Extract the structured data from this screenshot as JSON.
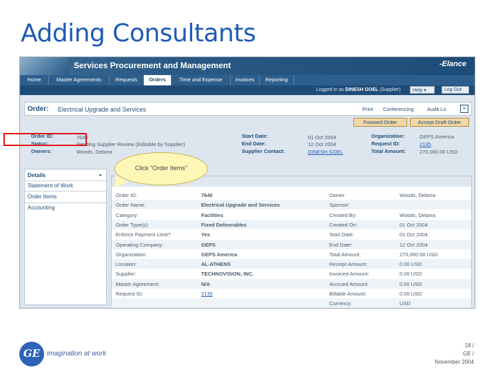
{
  "slide": {
    "title": "Adding Consultants",
    "footer": {
      "page": "18 /",
      "company": "GE /",
      "date": "November 2004"
    },
    "tagline": "imagination at work",
    "logo_text": "GE"
  },
  "app": {
    "banner_title": "Services Procurement and Management",
    "brand": "-Elance",
    "tabs": [
      "Home",
      "Master Agreements",
      "Requests",
      "Orders",
      "Time and Expense",
      "Invoices",
      "Reporting"
    ],
    "active_tab": "Orders",
    "user": {
      "prefix": "Logged in as",
      "name": "DINESH GOEL",
      "role": "(Supplier)",
      "help": "Help",
      "logout": "Log Out"
    },
    "order": {
      "label": "Order:",
      "name": "Electrical Upgrade and Services",
      "links": {
        "print": "Print",
        "conferencing": "Conferencing",
        "audit": "Audit Lo"
      },
      "close": "×"
    },
    "actions": {
      "forward": "Forward Order",
      "accept": "Accept Draft Order"
    },
    "summary": {
      "order_id_label": "Order ID:",
      "order_id": "7640",
      "status_label": "Status:",
      "status": "Pending Supplier Review (Editable by Supplier)",
      "owners_label": "Owners:",
      "owners": "Woods, Debora",
      "start_label": "Start Date:",
      "start": "01 Oct 2004",
      "end_label": "End Date:",
      "end": "12 Oct 2004",
      "contact_label": "Supplier Contact:",
      "contact": "DINESH GOEL",
      "org_label": "Organization:",
      "org": "GEPS America",
      "request_label": "Request ID:",
      "request": "2135",
      "total_label": "Total Amount:",
      "total": "270,000.00 USD"
    },
    "nav": {
      "items": [
        "Details",
        "Statement of Work",
        "Order Items",
        "Accounting"
      ],
      "arrow": "▸"
    },
    "callout": "Click \"Order Items\"",
    "details_left": [
      {
        "label": "Order ID:",
        "value": "7640"
      },
      {
        "label": "Order Name:",
        "value": "Electrical Upgrade and Services"
      },
      {
        "label": "Category:",
        "value": "Facilities"
      },
      {
        "label": "Order Type(s):",
        "value": "Fixed Deliverables"
      },
      {
        "label": "Enforce Payment Limit?",
        "value": "Yes"
      },
      {
        "label": "Operating Company:",
        "value": "GEPS"
      },
      {
        "label": "Organization:",
        "value": "GEPS America"
      },
      {
        "label": "Location:",
        "value": "AL-ATHENS"
      },
      {
        "label": "Supplier:",
        "value": "TECHNOVISION, INC."
      },
      {
        "label": "Master Agreement:",
        "value": "N/A"
      },
      {
        "label": "Request ID:",
        "value": "2135"
      }
    ],
    "details_right": [
      {
        "label": "Owner:",
        "value": "Woods, Debora"
      },
      {
        "label": "Sponsor:",
        "value": ""
      },
      {
        "label": "Created By:",
        "value": "Woods, Debora"
      },
      {
        "label": "Created On:",
        "value": "01 Oct 2004"
      },
      {
        "label": "Start Date:",
        "value": "01 Oct 2004"
      },
      {
        "label": "End Date:",
        "value": "12 Oct 2004"
      },
      {
        "label": "Total Amount:",
        "value": "270,000.00 USD"
      },
      {
        "label": "Receipt Amount:",
        "value": "0.00 USD"
      },
      {
        "label": "Invoiced Amount:",
        "value": "0.00 USD"
      },
      {
        "label": "Accrued Amount:",
        "value": "0.00 USD"
      },
      {
        "label": "Billable Amount:",
        "value": "0.00 USD"
      },
      {
        "label": "Currency:",
        "value": "USD"
      }
    ]
  }
}
